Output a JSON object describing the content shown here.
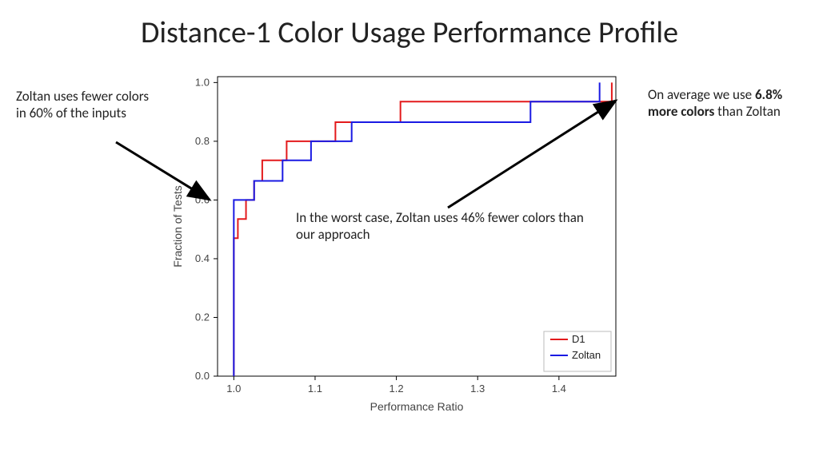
{
  "title": "Distance-1 Color Usage Performance Profile",
  "annotations": {
    "left": "Zoltan uses fewer colors in 60% of the inputs",
    "right_pre": "On average we use ",
    "right_bold": "6.8% more colors",
    "right_post": " than Zoltan",
    "center": "In the worst case, Zoltan uses 46% fewer colors than our approach"
  },
  "chart_data": {
    "type": "line",
    "step": true,
    "xlabel": "Performance Ratio",
    "ylabel": "Fraction of Tests",
    "xlim": [
      0.98,
      1.47
    ],
    "ylim": [
      0.0,
      1.02
    ],
    "xticks": [
      1.0,
      1.1,
      1.2,
      1.3,
      1.4
    ],
    "yticks": [
      0.0,
      0.2,
      0.4,
      0.6,
      0.8,
      1.0
    ],
    "legend_position": "lower right",
    "series": [
      {
        "name": "D1",
        "color": "#e31a1c",
        "x": [
          1.0,
          1.0,
          1.005,
          1.005,
          1.015,
          1.015,
          1.025,
          1.025,
          1.035,
          1.035,
          1.065,
          1.065,
          1.125,
          1.125,
          1.205,
          1.205,
          1.445,
          1.445,
          1.465,
          1.465
        ],
        "y": [
          0.0,
          0.47,
          0.47,
          0.535,
          0.535,
          0.6,
          0.6,
          0.665,
          0.665,
          0.735,
          0.735,
          0.8,
          0.8,
          0.865,
          0.865,
          0.935,
          0.935,
          0.935,
          0.935,
          1.0
        ]
      },
      {
        "name": "Zoltan",
        "color": "#1a1ae3",
        "x": [
          1.0,
          1.0,
          1.025,
          1.025,
          1.06,
          1.06,
          1.095,
          1.095,
          1.145,
          1.145,
          1.365,
          1.365,
          1.45,
          1.45
        ],
        "y": [
          0.0,
          0.6,
          0.6,
          0.665,
          0.665,
          0.735,
          0.735,
          0.8,
          0.8,
          0.865,
          0.865,
          0.935,
          0.935,
          1.0
        ]
      }
    ]
  }
}
